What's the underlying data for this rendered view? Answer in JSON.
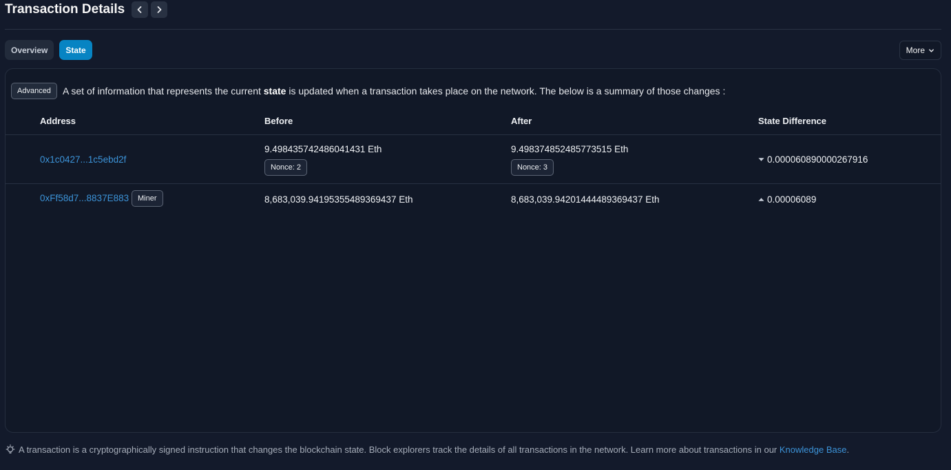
{
  "header": {
    "title": "Transaction Details",
    "prev_icon": "chevron-left-icon",
    "next_icon": "chevron-right-icon"
  },
  "tabs": [
    {
      "label": "Overview",
      "active": false
    },
    {
      "label": "State",
      "active": true
    }
  ],
  "more_button": {
    "label": "More",
    "icon": "chevron-down-icon"
  },
  "intro": {
    "badge": "Advanced",
    "text_before": "A set of information that represents the current",
    "bold": "state",
    "text_after": "is updated when a transaction takes place on the network. The below is a summary of those changes :"
  },
  "table": {
    "columns": [
      "Address",
      "Before",
      "After",
      "State Difference"
    ],
    "rows": [
      {
        "address": "0x1c0427...1c5ebd2f",
        "before": "9.498435742486041431 Eth",
        "before_nonce": "Nonce: 2",
        "after": "9.498374852485773515 Eth",
        "after_nonce": "Nonce: 3",
        "diff": "0.000060890000267916",
        "diff_direction": "down"
      },
      {
        "address": "0xFf58d7...8837E883",
        "address_badge": "Miner",
        "before": "8,683,039.94195355489369437 Eth",
        "after": "8,683,039.94201444489369437 Eth",
        "diff": "0.00006089",
        "diff_direction": "up"
      }
    ]
  },
  "footer": {
    "icon": "lightbulb-icon",
    "text": "A transaction is a cryptographically signed instruction that changes the blockchain state. Block explorers track the details of all transactions in the network. Learn more about transactions in our",
    "link": "Knowledge Base",
    "end": "."
  },
  "colors": {
    "accent": "#0784c3",
    "link": "#3c93d8",
    "background": "#131a2b",
    "card": "#111827"
  }
}
